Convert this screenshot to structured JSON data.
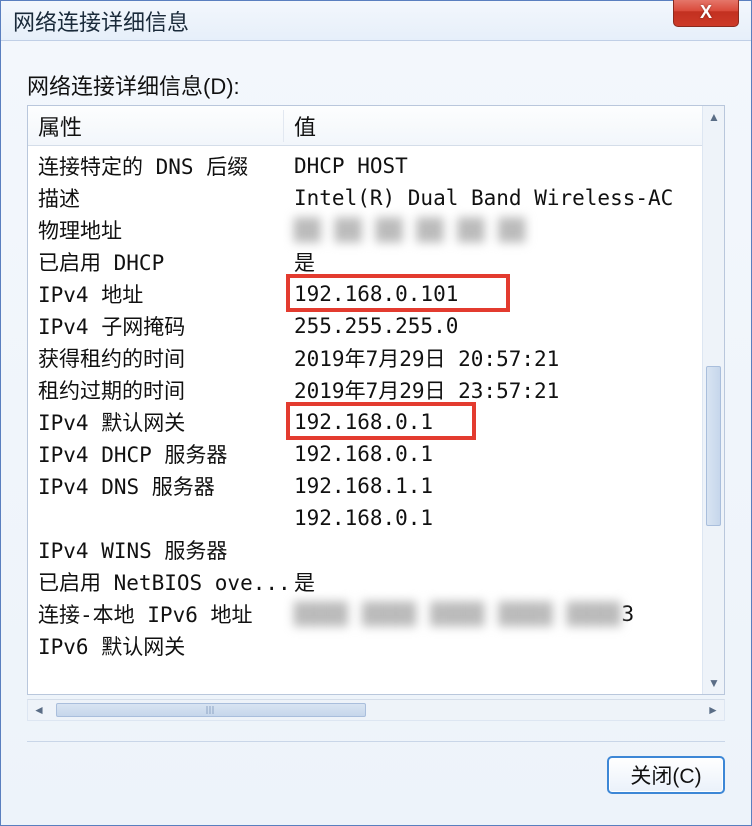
{
  "window": {
    "title": "网络连接详细信息",
    "close_x": "X"
  },
  "section_label": "网络连接详细信息(D):",
  "columns": {
    "prop": "属性",
    "val": "值"
  },
  "rows": [
    {
      "prop": "连接特定的 DNS 后缀",
      "val": "DHCP HOST"
    },
    {
      "prop": "描述",
      "val": "Intel(R) Dual Band Wireless-AC"
    },
    {
      "prop": "物理地址",
      "val": ""
    },
    {
      "prop": "已启用 DHCP",
      "val": "是"
    },
    {
      "prop": "IPv4 地址",
      "val": "192.168.0.101"
    },
    {
      "prop": "IPv4 子网掩码",
      "val": "255.255.255.0"
    },
    {
      "prop": "获得租约的时间",
      "val": "2019年7月29日 20:57:21"
    },
    {
      "prop": "租约过期的时间",
      "val": "2019年7月29日 23:57:21"
    },
    {
      "prop": "IPv4 默认网关",
      "val": "192.168.0.1"
    },
    {
      "prop": "IPv4 DHCP 服务器",
      "val": "192.168.0.1"
    },
    {
      "prop": "IPv4 DNS 服务器",
      "val": "192.168.1.1"
    },
    {
      "prop": "",
      "val": "192.168.0.1"
    },
    {
      "prop": "IPv4 WINS 服务器",
      "val": ""
    },
    {
      "prop": "已启用 NetBIOS ove...",
      "val": "是"
    },
    {
      "prop": "连接-本地 IPv6 地址",
      "val": ""
    },
    {
      "prop": "IPv6 默认网关",
      "val": ""
    }
  ],
  "masked_physical_address": "██ ██ ██ ██ ██ ██",
  "masked_ipv6_fragment_end": "3",
  "close_button": "关闭(C)",
  "highlights": {
    "ipv4_address_row_index": 4,
    "ipv4_gateway_row_index": 8
  }
}
